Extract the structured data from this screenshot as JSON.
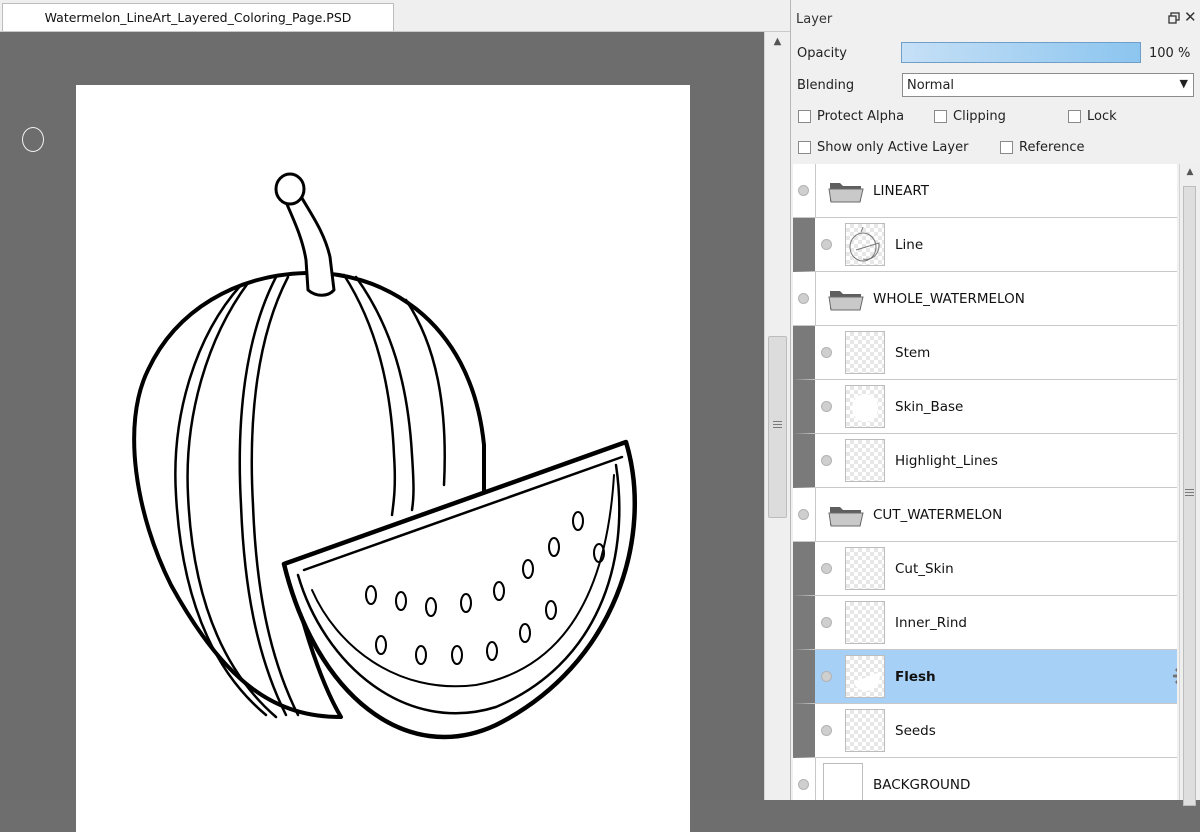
{
  "document": {
    "tab_title": "Watermelon_LineArt_Layered_Coloring_Page.PSD"
  },
  "layer_panel": {
    "title": "Layer",
    "opacity_label": "Opacity",
    "opacity_value": "100 %",
    "opacity_fraction": 1.0,
    "blending_label": "Blending",
    "blending_value": "Normal",
    "checkboxes": {
      "protect_alpha": "Protect Alpha",
      "clipping": "Clipping",
      "lock": "Lock",
      "show_only_active": "Show only Active Layer",
      "reference": "Reference"
    },
    "layers": [
      {
        "name": "LINEART",
        "type": "group"
      },
      {
        "name": "Line",
        "type": "layer"
      },
      {
        "name": "WHOLE_WATERMELON",
        "type": "group"
      },
      {
        "name": "Stem",
        "type": "layer"
      },
      {
        "name": "Skin_Base",
        "type": "layer"
      },
      {
        "name": "Highlight_Lines",
        "type": "layer"
      },
      {
        "name": "CUT_WATERMELON",
        "type": "group"
      },
      {
        "name": "Cut_Skin",
        "type": "layer"
      },
      {
        "name": "Inner_Rind",
        "type": "layer"
      },
      {
        "name": "Flesh",
        "type": "layer",
        "selected": true
      },
      {
        "name": "Seeds",
        "type": "layer"
      },
      {
        "name": "BACKGROUND",
        "type": "background"
      }
    ]
  },
  "colors": {
    "selection": "#a7d0f7",
    "opacity_bar": "#8cc5ef",
    "canvas_bg": "#6d6d6d"
  }
}
